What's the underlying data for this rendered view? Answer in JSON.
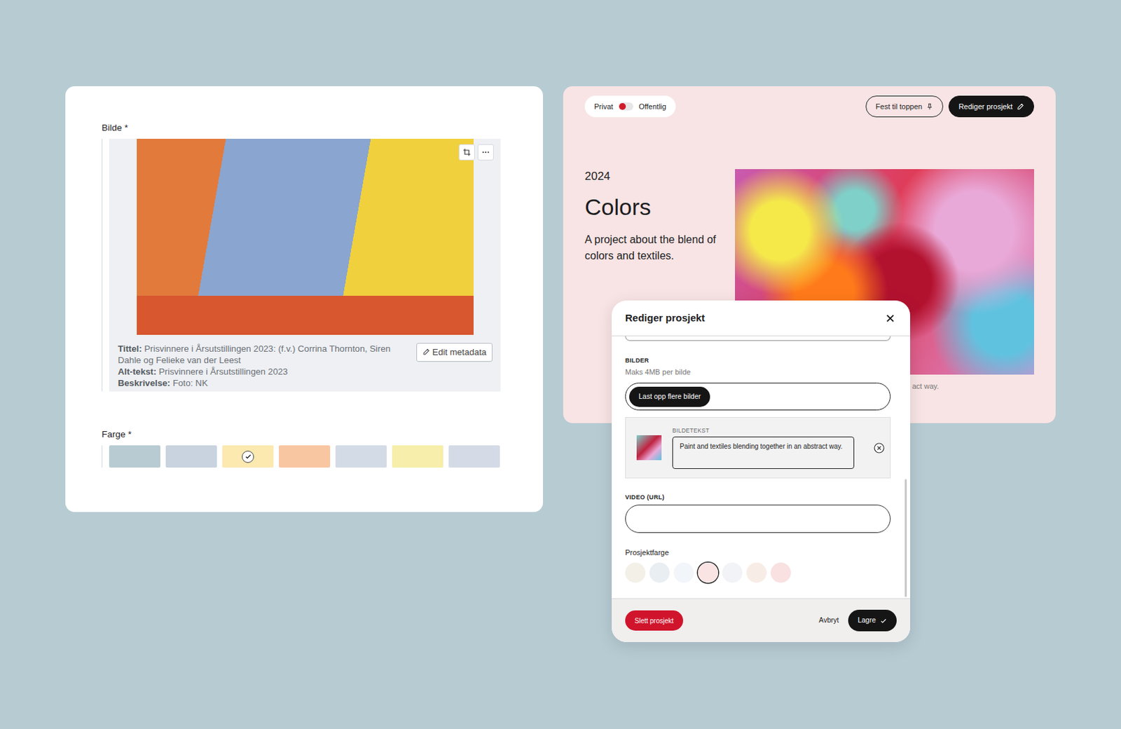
{
  "metadata_card": {
    "image_label": "Bilde *",
    "meta": [
      {
        "key": "Tittel:",
        "value": "Prisvinnere i Årsutstillingen 2023: (f.v.) Corrina Thornton, Siren Dahle og Felieke van der Leest"
      },
      {
        "key": "Alt-tekst:",
        "value": "Prisvinnere i Årsutstillingen 2023"
      },
      {
        "key": "Beskrivelse:",
        "value": "Foto: NK"
      }
    ],
    "edit_button": "Edit metadata",
    "color_label": "Farge *",
    "swatches": [
      {
        "color": "#b8cbd3",
        "selected": false
      },
      {
        "color": "#c9d3df",
        "selected": false
      },
      {
        "color": "#fbe9b0",
        "selected": true
      },
      {
        "color": "#f9c6a2",
        "selected": false
      },
      {
        "color": "#d3dbe6",
        "selected": false
      },
      {
        "color": "#f6eeaa",
        "selected": false
      },
      {
        "color": "#d4dbe6",
        "selected": false
      }
    ]
  },
  "project": {
    "visibility": {
      "private_label": "Privat",
      "public_label": "Offentlig",
      "public": false
    },
    "pin_button": "Fest til toppen",
    "edit_button": "Rediger prosjekt",
    "year": "2024",
    "title": "Colors",
    "description": "A project about the blend of colors and textiles.",
    "image_caption": "act way."
  },
  "modal": {
    "title": "Rediger prosjekt",
    "images_label": "BILDER",
    "images_hint": "Maks 4MB per bilde",
    "upload_button": "Last opp flere bilder",
    "image_items": [
      {
        "caption_label": "BILDETEKST",
        "caption": "Paint and textiles blending together in an abstract way."
      }
    ],
    "video_label": "VIDEO (URL)",
    "video_value": "",
    "color_label": "Prosjektfarge",
    "swatches": [
      {
        "color": "#f3f0e8",
        "selected": false
      },
      {
        "color": "#e9eef3",
        "selected": false
      },
      {
        "color": "#f2f5fa",
        "selected": false
      },
      {
        "color": "#f9e3e3",
        "selected": true
      },
      {
        "color": "#f1f3f7",
        "selected": false
      },
      {
        "color": "#f8ede6",
        "selected": false
      },
      {
        "color": "#f9e1e1",
        "selected": false
      }
    ],
    "delete_button": "Slett prosjekt",
    "cancel_button": "Avbryt",
    "save_button": "Lagre"
  }
}
